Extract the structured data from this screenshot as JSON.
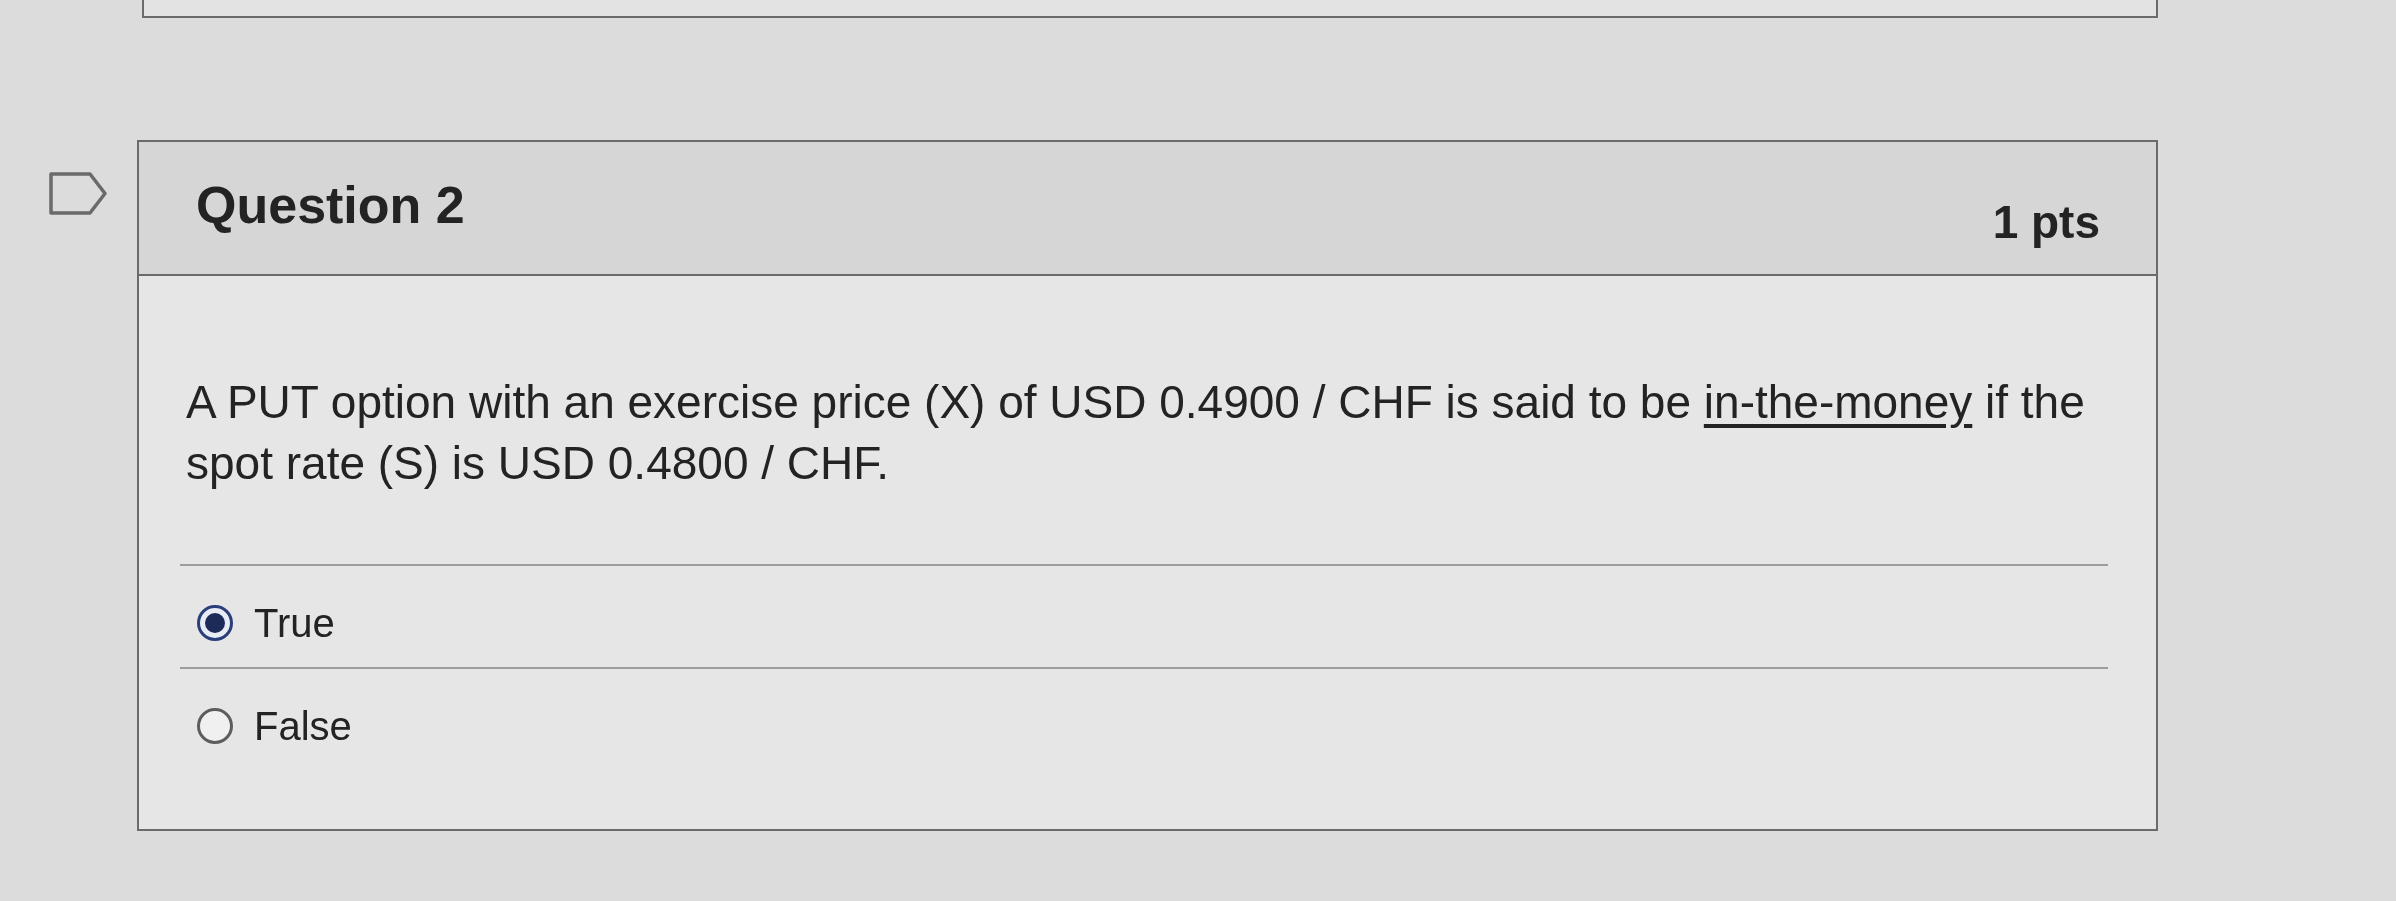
{
  "question": {
    "title": "Question 2",
    "points": "1 pts",
    "flagged": false,
    "text": {
      "before": "A PUT option with an exercise price (X) of USD 0.4900 / CHF is said to be ",
      "link": "in-the-money",
      "after": " if the spot rate (S) is USD 0.4800 / CHF."
    },
    "answers": [
      {
        "label": "True",
        "selected": true
      },
      {
        "label": "False",
        "selected": false
      }
    ]
  }
}
